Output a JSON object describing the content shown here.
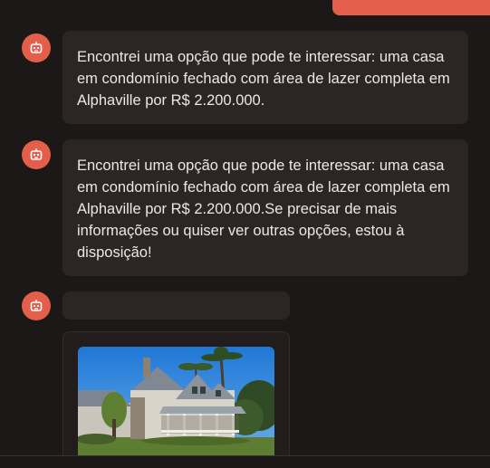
{
  "chat": {
    "messages": [
      {
        "role": "assistant",
        "text": "Encontrei uma opção que pode te interessar: uma casa em condomínio fechado com área de lazer completa em Alphaville por R$ 2.200.000."
      },
      {
        "role": "assistant",
        "text": "Encontrei uma opção que pode te interessar: uma casa em condomínio fechado com área de lazer completa em Alphaville por R$ 2.200.000.Se precisar de mais informações ou quiser ver outras opções, estou à disposição!"
      },
      {
        "role": "assistant",
        "text": ""
      }
    ],
    "property_card": {
      "image_icon": "house-photo"
    }
  },
  "colors": {
    "background": "#1c1817",
    "bubble": "#2b2523",
    "accent": "#e35f4c",
    "text": "#ece7e4"
  },
  "icons": {
    "avatar": "robot-icon"
  }
}
